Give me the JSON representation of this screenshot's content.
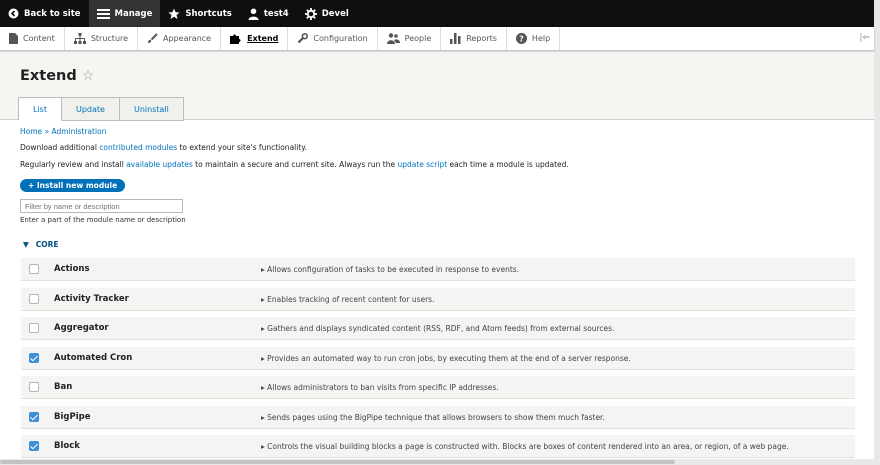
{
  "toolbar": {
    "items": [
      {
        "label": "Back to site",
        "icon": "back-circle-icon"
      },
      {
        "label": "Manage",
        "icon": "hamburger-icon"
      },
      {
        "label": "Shortcuts",
        "icon": "star-icon"
      },
      {
        "label": "test4",
        "icon": "user-icon"
      },
      {
        "label": "Devel",
        "icon": "gear-icon"
      }
    ]
  },
  "tray": {
    "items": [
      {
        "label": "Content",
        "icon": "document-icon"
      },
      {
        "label": "Structure",
        "icon": "structure-icon"
      },
      {
        "label": "Appearance",
        "icon": "brush-icon"
      },
      {
        "label": "Extend",
        "icon": "puzzle-icon"
      },
      {
        "label": "Configuration",
        "icon": "wrench-icon"
      },
      {
        "label": "People",
        "icon": "people-icon"
      },
      {
        "label": "Reports",
        "icon": "bar-chart-icon"
      },
      {
        "label": "Help",
        "icon": "help-icon"
      }
    ],
    "toggle": "|⇐"
  },
  "page": {
    "title": "Extend",
    "star": "☆",
    "tabs": [
      {
        "label": "List"
      },
      {
        "label": "Update"
      },
      {
        "label": "Uninstall"
      }
    ]
  },
  "breadcrumb": "Home » Administration",
  "intro": {
    "download_pre": "Download additional ",
    "download_link": "contributed modules",
    "download_post": " to extend your site's functionality.",
    "review_pre": "Regularly review and install ",
    "review_link1": "available updates",
    "review_mid": " to maintain a secure and current site. Always run the ",
    "review_link2": "update script",
    "review_post": " each time a module is updated."
  },
  "install_button": "+ Install new module",
  "filter": {
    "placeholder": "Filter by name or description",
    "description": "Enter a part of the module name or description"
  },
  "core": {
    "label": "CORE",
    "arrow": "▼",
    "desc_arrow": "▸",
    "modules": [
      {
        "name": "Actions",
        "checked": false,
        "description": "Allows configuration of tasks to be executed in response to events."
      },
      {
        "name": "Activity Tracker",
        "checked": false,
        "description": "Enables tracking of recent content for users."
      },
      {
        "name": "Aggregator",
        "checked": false,
        "description": "Gathers and displays syndicated content (RSS, RDF, and Atom feeds) from external sources."
      },
      {
        "name": "Automated Cron",
        "checked": true,
        "description": "Provides an automated way to run cron jobs, by executing them at the end of a server response."
      },
      {
        "name": "Ban",
        "checked": false,
        "description": "Allows administrators to ban visits from specific IP addresses."
      },
      {
        "name": "BigPipe",
        "checked": true,
        "description": "Sends pages using the BigPipe technique that allows browsers to show them much faster."
      },
      {
        "name": "Block",
        "checked": true,
        "description": "Controls the visual building blocks a page is constructed with. Blocks are boxes of content rendered into an area, or region, of a web page."
      }
    ]
  },
  "colors": {
    "accent": "#0074bd",
    "button": "#0071b8",
    "checked": "#3f8fd6"
  }
}
